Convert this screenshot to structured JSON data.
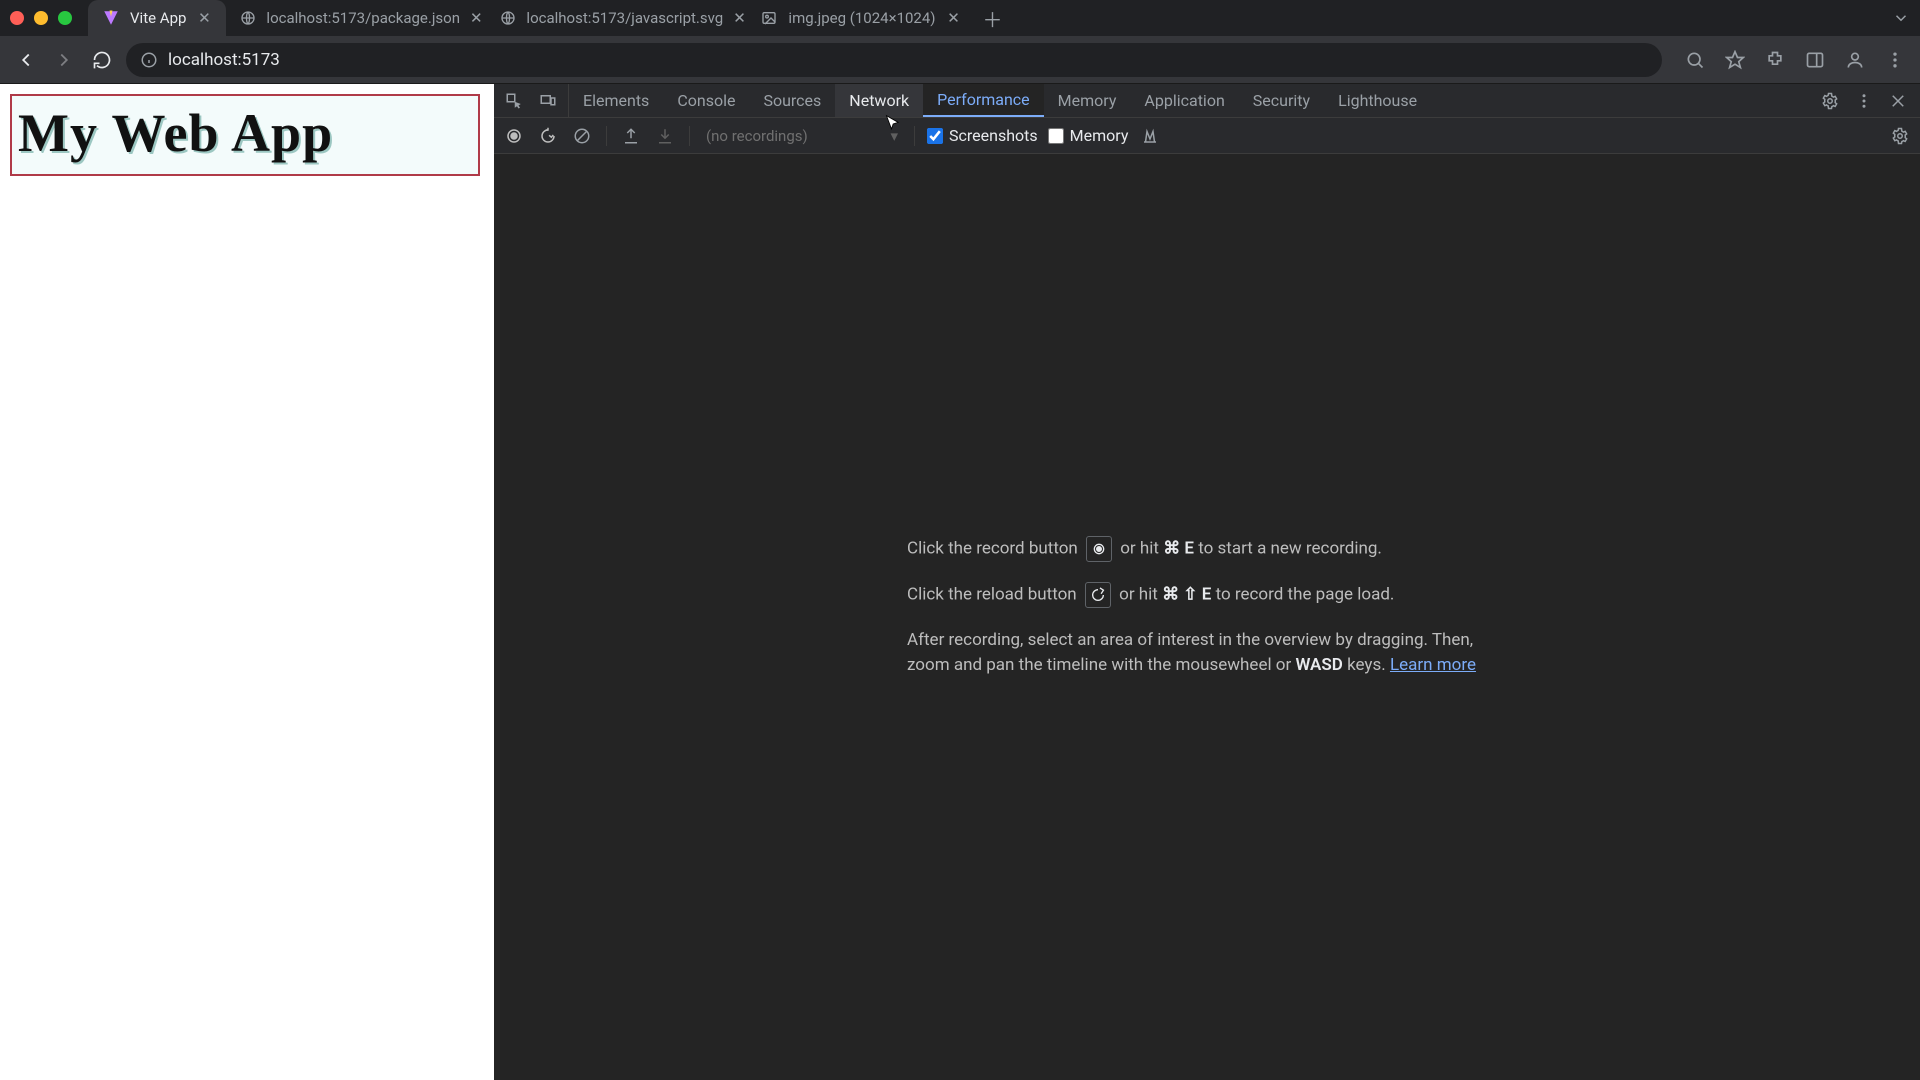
{
  "tabs": [
    {
      "title": "Vite App",
      "active": true
    },
    {
      "title": "localhost:5173/package.json",
      "active": false
    },
    {
      "title": "localhost:5173/javascript.svg",
      "active": false
    },
    {
      "title": "img.jpeg (1024×1024)",
      "active": false
    }
  ],
  "omnibox": {
    "url": "localhost:5173"
  },
  "page": {
    "heading": "My Web App"
  },
  "devtools": {
    "panels": [
      "Elements",
      "Console",
      "Sources",
      "Network",
      "Performance",
      "Memory",
      "Application",
      "Security",
      "Lighthouse"
    ],
    "active_panel": "Performance",
    "hover_panel": "Network",
    "recordings_placeholder": "(no recordings)",
    "screenshots_label": "Screenshots",
    "memory_label": "Memory",
    "screenshots_checked": true,
    "memory_checked": false,
    "hints": {
      "record_pre": "Click the record button ",
      "record_post_a": " or hit ",
      "record_key": "⌘ E",
      "record_post_b": " to start a new recording.",
      "reload_pre": "Click the reload button ",
      "reload_post_a": " or hit ",
      "reload_key": "⌘ ⇧ E",
      "reload_post_b": " to record the page load.",
      "after_a": "After recording, select an area of interest in the overview by dragging. Then, zoom and pan the timeline with the mousewheel or ",
      "after_key": "WASD",
      "after_b": " keys. ",
      "learn_more": "Learn more"
    }
  }
}
